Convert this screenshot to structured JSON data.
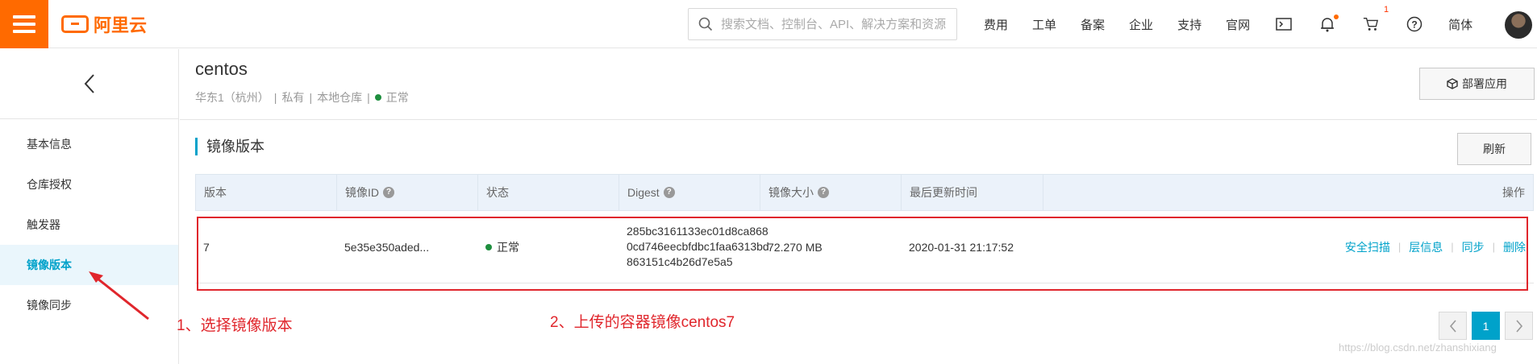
{
  "topbar": {
    "logo_text": "阿里云",
    "search_placeholder": "搜索文档、控制台、API、解决方案和资源",
    "nav_items": [
      "费用",
      "工单",
      "备案",
      "企业",
      "支持",
      "官网"
    ],
    "cart_count": "1",
    "language": "简体"
  },
  "sidebar": {
    "items": [
      {
        "label": "基本信息"
      },
      {
        "label": "仓库授权"
      },
      {
        "label": "触发器"
      },
      {
        "label": "镜像版本"
      },
      {
        "label": "镜像同步"
      }
    ]
  },
  "repo": {
    "name": "centos",
    "region": "华东1（杭州）",
    "visibility": "私有",
    "source": "本地仓库",
    "status": "正常",
    "deploy_label": "部署应用"
  },
  "section": {
    "title": "镜像版本",
    "refresh_label": "刷新"
  },
  "table": {
    "headers": {
      "version": "版本",
      "image_id": "镜像ID",
      "status": "状态",
      "digest": "Digest",
      "size": "镜像大小",
      "updated": "最后更新时间",
      "actions": "操作"
    },
    "rows": [
      {
        "version": "7",
        "image_id": "5e35e350aded...",
        "status": "正常",
        "digest_line1": "285bc3161133ec01d8ca868",
        "digest_line2": "0cd746eecbfdbc1faa6313bd",
        "digest_line3": "863151c4b26d7e5a5",
        "size": "72.270 MB",
        "updated": "2020-01-31 21:17:52",
        "actions": [
          "安全扫描",
          "层信息",
          "同步",
          "删除"
        ]
      }
    ]
  },
  "annotations": {
    "note1": "1、选择镜像版本",
    "note2": "2、上传的容器镜像centos7"
  },
  "pagination": {
    "current": "1"
  },
  "watermark": "https://blog.csdn.net/zhanshixiang",
  "colors": {
    "brand": "#ff6a00",
    "accent": "#00a2ca",
    "annotation": "#e0262c",
    "status_ok": "#1e8e3e"
  }
}
